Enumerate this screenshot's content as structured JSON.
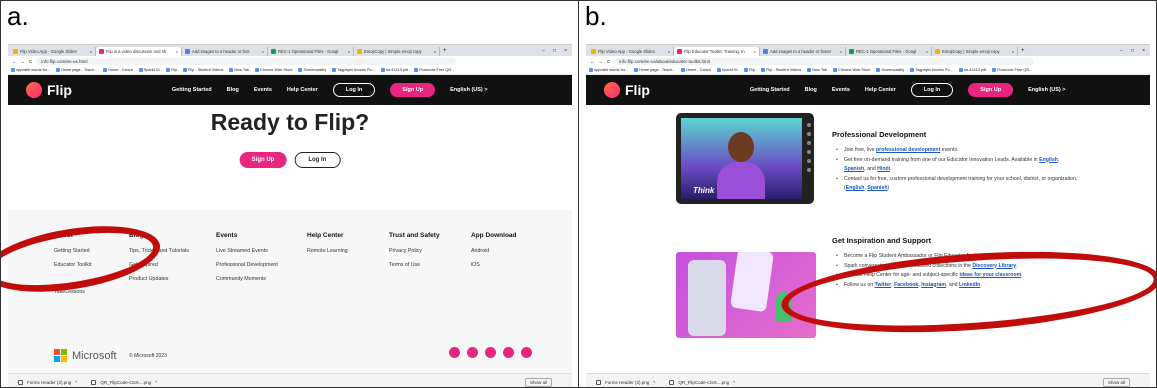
{
  "panel_a": {
    "label": "a.",
    "browser": {
      "tabs": [
        {
          "title": "Flip Video App - Google Slides",
          "color": "#f4b400"
        },
        {
          "title": "Flip is a video discussion and sh",
          "color": "#e8267f",
          "active": true
        },
        {
          "title": "Add images to a header or foot",
          "color": "#4285f4"
        },
        {
          "title": "REC-1 Operational Files - Googl",
          "color": "#0f9d58"
        },
        {
          "title": "EmojiCopy | Simple emoji copy",
          "color": "#f4b400"
        }
      ],
      "url": "info.flip.com/en-us.html",
      "bookmarks": [
        "opposite words for...",
        "Home page - Teach...",
        "Home - Canva",
        "Spark101",
        "Flip",
        "Flip - Student Videos",
        "New Tab",
        "Chrome Web Store",
        "Screencastify",
        "Tagpayer Access Po...",
        "tnt-41413.pdf",
        "Flowcode Free QR..."
      ]
    },
    "nav": {
      "logo": "Flip",
      "links": [
        "Getting Started",
        "Blog",
        "Events",
        "Help Center"
      ],
      "login": "Log In",
      "signup": "Sign Up",
      "language": "English (US)",
      "chevron": ">"
    },
    "hero": {
      "title": "Ready to Flip?",
      "signup": "Sign Up",
      "login": "Log In"
    },
    "footer": {
      "columns": [
        {
          "head": "About",
          "items": [
            "Getting Started",
            "Educator Toolkit",
            "",
            "TakeLessons"
          ]
        },
        {
          "head": "Blog",
          "items": [
            "Tips, Tricks, and Tutorials",
            "Get Inspired",
            "Product Updates"
          ]
        },
        {
          "head": "Events",
          "items": [
            "Live Streamed Events",
            "Professional Development",
            "Community Moments"
          ]
        },
        {
          "head": "Help Center",
          "items": [
            "Remote Learning"
          ]
        },
        {
          "head": "Trust and Safety",
          "items": [
            "Privacy Policy",
            "Terms of Use"
          ]
        },
        {
          "head": "App Download",
          "items": [
            "Android",
            "iOS"
          ]
        }
      ],
      "brand": "Microsoft",
      "copyright": "© Microsoft 2023",
      "social_icons": [
        "facebook-icon",
        "pinterest-icon",
        "linkedin-icon",
        "youtube-icon",
        "instagram-icon"
      ]
    },
    "downloads": [
      "Forms Header (2).png",
      "QR_FlipCode-c2c6....png"
    ],
    "show_all": "Show all"
  },
  "panel_b": {
    "label": "b.",
    "browser": {
      "tabs": [
        {
          "title": "Flip Video App - Google Slides",
          "color": "#f4b400"
        },
        {
          "title": "Flip Educator Toolkit: Training, In",
          "color": "#e8267f",
          "active": true
        },
        {
          "title": "Add images to a header or footer",
          "color": "#4285f4"
        },
        {
          "title": "REC-1 Operational Files - Googl",
          "color": "#0f9d58"
        },
        {
          "title": "EmojiCopy | Simple emoji copy",
          "color": "#f4b400"
        }
      ],
      "url": "info.flip.com/en-us/about/educator-toolkit.html"
    },
    "professional": {
      "title": "Professional Development",
      "video_text": "Think",
      "bullets": [
        [
          "Join free, live ",
          "professional development",
          " events."
        ],
        [
          "Get free on-demand training from one of our Educator Innovation Leads. Available in ",
          "English",
          ", ",
          "Spanish",
          ", and ",
          "Hindi",
          "."
        ],
        [
          "Contact us for free, custom professional development training for your school, district, or organization. (",
          "English",
          ", ",
          "Spanish",
          ")"
        ]
      ]
    },
    "inspiration": {
      "title": "Get Inspiration and Support",
      "bullets": [
        [
          "Become a Flip Student Ambassador or Flip Educator Ambassador."
        ],
        [
          "Spark conversations with our featured collections in the ",
          "Discovery Library",
          "."
        ],
        [
          "Visit our Help Center for age- and subject-specific ",
          "ideas for your classroom",
          "."
        ],
        [
          "Follow us on ",
          "Twitter",
          ", ",
          "Facebook",
          ", ",
          "Instagram",
          ", and ",
          "LinkedIn",
          "."
        ]
      ]
    },
    "downloads": [
      "Forms Header (2).png",
      "QR_FlipCode-c2c6....png"
    ],
    "show_all": "Show all"
  },
  "colors": {
    "brand_pink": "#e8267f",
    "annotation_red": "#c20c0c",
    "nav_bg": "#111111",
    "link_blue": "#1a56c5"
  }
}
